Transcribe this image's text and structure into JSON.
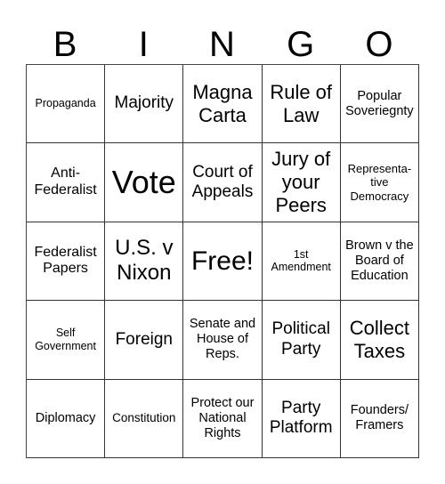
{
  "header": {
    "letters": [
      "B",
      "I",
      "N",
      "G",
      "O"
    ]
  },
  "cells": [
    [
      "Propaganda",
      "Majority",
      "Magna Carta",
      "Rule of Law",
      "Popular Soveriegnty"
    ],
    [
      "Anti-Federalist",
      "Vote",
      "Court of Appeals",
      "Jury of your Peers",
      "Representa-tive Democracy"
    ],
    [
      "Federalist Papers",
      "U.S. v Nixon",
      "Free!",
      "1st Amendment",
      "Brown v the Board of Education"
    ],
    [
      "Self Government",
      "Foreign",
      "Senate and House of Reps.",
      "Political Party",
      "Collect Taxes"
    ],
    [
      "Diplomacy",
      "Constitution",
      "Protect our National Rights",
      "Party Platform",
      "Founders/ Framers"
    ]
  ],
  "free_space": {
    "row": 2,
    "col": 2,
    "label": "Free!"
  }
}
